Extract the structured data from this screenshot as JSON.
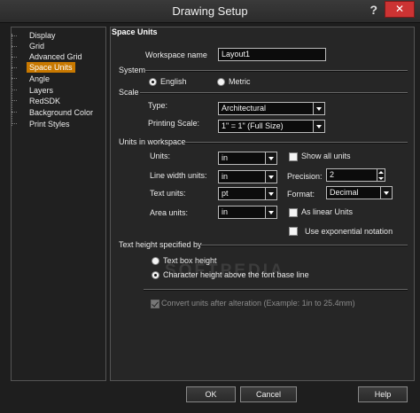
{
  "window": {
    "title": "Drawing Setup",
    "help_glyph": "?",
    "close_glyph": "✕"
  },
  "sidebar": {
    "items": [
      {
        "label": "Display"
      },
      {
        "label": "Grid"
      },
      {
        "label": "Advanced Grid"
      },
      {
        "label": "Space Units",
        "selected": true
      },
      {
        "label": "Angle"
      },
      {
        "label": "Layers"
      },
      {
        "label": "RedSDK"
      },
      {
        "label": "Background Color"
      },
      {
        "label": "Print Styles"
      }
    ]
  },
  "panel": {
    "title": "Space Units",
    "workspace_name_label": "Workspace name",
    "workspace_name_value": "Layout1",
    "system": {
      "label": "System",
      "english": "English",
      "metric": "Metric",
      "selected": "English"
    },
    "scale": {
      "label": "Scale",
      "type_label": "Type:",
      "type_value": "Architectural",
      "printing_scale_label": "Printing Scale:",
      "printing_scale_value": "1\" = 1\" (Full Size)"
    },
    "units": {
      "label": "Units in workspace",
      "units_label": "Units:",
      "units_value": "in",
      "line_width_label": "Line width units:",
      "line_width_value": "in",
      "text_units_label": "Text units:",
      "text_units_value": "pt",
      "area_units_label": "Area units:",
      "area_units_value": "in",
      "show_all_units": "Show all units",
      "precision_label": "Precision:",
      "precision_value": "2",
      "format_label": "Format:",
      "format_value": "Decimal",
      "as_linear_units": "As linear Units",
      "exponential": "Use exponential notation"
    },
    "text_height": {
      "label": "Text height specified by",
      "option1": "Text box height",
      "option2": "Character height above the font base line",
      "selected": "option2"
    },
    "convert_units": "Convert units after alteration (Example: 1in to 25.4mm)",
    "watermark": "SOFTPEDIA"
  },
  "buttons": {
    "ok": "OK",
    "cancel": "Cancel",
    "help": "Help"
  }
}
